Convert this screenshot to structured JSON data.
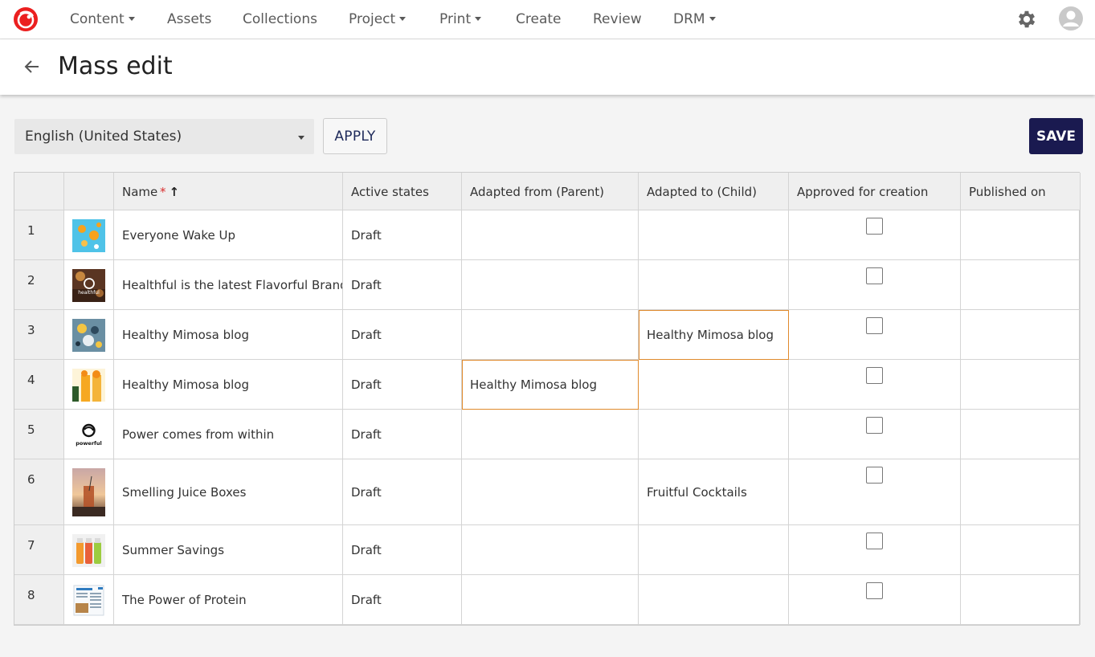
{
  "nav": {
    "items": [
      {
        "label": "Content",
        "dropdown": true
      },
      {
        "label": "Assets",
        "dropdown": false
      },
      {
        "label": "Collections",
        "dropdown": false
      },
      {
        "label": "Project",
        "dropdown": true
      },
      {
        "label": "Print",
        "dropdown": true
      },
      {
        "label": "Create",
        "dropdown": false
      },
      {
        "label": "Review",
        "dropdown": false
      },
      {
        "label": "DRM",
        "dropdown": true
      }
    ],
    "settings_icon": "gear-icon",
    "avatar_icon": "user-avatar-icon",
    "logo_icon": "sitecore-logo-icon",
    "brand_color": "#eb1f1f"
  },
  "header": {
    "title": "Mass edit",
    "back_icon": "arrow-left-icon"
  },
  "toolbar": {
    "language": "English (United States)",
    "apply_label": "APPLY",
    "save_label": "SAVE",
    "save_color": "#1a1a50"
  },
  "table": {
    "columns": {
      "name": "Name",
      "required_mark": "*",
      "sort_indicator": "↑",
      "active_states": "Active states",
      "adapted_from": "Adapted from (Parent)",
      "adapted_to": "Adapted to (Child)",
      "approved": "Approved for creation",
      "published": "Published on"
    },
    "highlight_color": "#e08a2c",
    "rows": [
      {
        "num": "1",
        "name": "Everyone Wake Up",
        "state": "Draft",
        "parent": "",
        "child": "",
        "approved": false,
        "published": "",
        "thumb": "citrus-on-blue-thumbnail"
      },
      {
        "num": "2",
        "name": "Healthful is the latest Flavorful Brand",
        "state": "Draft",
        "parent": "",
        "child": "",
        "approved": false,
        "published": "",
        "thumb": "healthful-logo-thumbnail"
      },
      {
        "num": "3",
        "name": "Healthy Mimosa blog",
        "state": "Draft",
        "parent": "",
        "child": "Healthy Mimosa blog",
        "approved": false,
        "published": "",
        "thumb": "fruit-flatlay-thumbnail"
      },
      {
        "num": "4",
        "name": "Healthy Mimosa blog",
        "state": "Draft",
        "parent": "Healthy Mimosa blog",
        "child": "",
        "approved": false,
        "published": "",
        "thumb": "mimosa-glasses-thumbnail"
      },
      {
        "num": "5",
        "name": "Power comes from within",
        "state": "Draft",
        "parent": "",
        "child": "",
        "approved": false,
        "published": "",
        "thumb": "powerful-logo-thumbnail"
      },
      {
        "num": "6",
        "name": "Smelling Juice Boxes",
        "state": "Draft",
        "parent": "",
        "child": "Fruitful Cocktails",
        "approved": false,
        "published": "",
        "thumb": "sunset-drink-thumbnail"
      },
      {
        "num": "7",
        "name": "Summer Savings",
        "state": "Draft",
        "parent": "",
        "child": "",
        "approved": false,
        "published": "",
        "thumb": "juice-bottles-thumbnail"
      },
      {
        "num": "8",
        "name": "The Power of Protein",
        "state": "Draft",
        "parent": "",
        "child": "",
        "approved": false,
        "published": "",
        "thumb": "document-page-thumbnail"
      }
    ],
    "thumb_logos": {
      "healthful": "healthful",
      "powerful": "powerful"
    }
  }
}
